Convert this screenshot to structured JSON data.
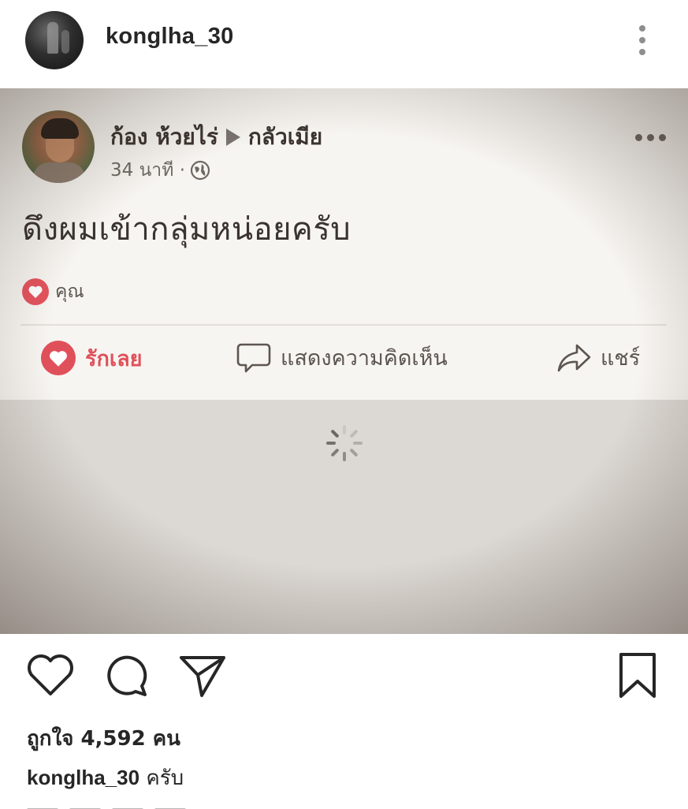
{
  "instagram": {
    "header": {
      "username": "konglha_30",
      "more_icon": "more-vertical-icon"
    },
    "actions": {
      "like_icon": "heart-outline-icon",
      "comment_icon": "comment-icon",
      "share_icon": "send-icon",
      "save_icon": "bookmark-icon"
    },
    "likes_text": "ถูกใจ 4,592 คน",
    "caption": {
      "username": "konglha_30",
      "text": "ครับ"
    }
  },
  "facebook_post": {
    "author": "ก้อง ห้วยไร่",
    "group": "กลัวเมีย",
    "time": "34 นาที ·",
    "privacy_icon": "globe-icon",
    "message": "ดึงผมเข้ากลุ่มหน่อยครับ",
    "reaction_summary": "คุณ",
    "actions": {
      "love": "รักเลย",
      "comment": "แสดงความคิดเห็น",
      "share": "แชร์"
    }
  },
  "colors": {
    "love_red": "#e0505b",
    "ig_text": "#262626",
    "fb_bg": "#f7f5f1"
  }
}
